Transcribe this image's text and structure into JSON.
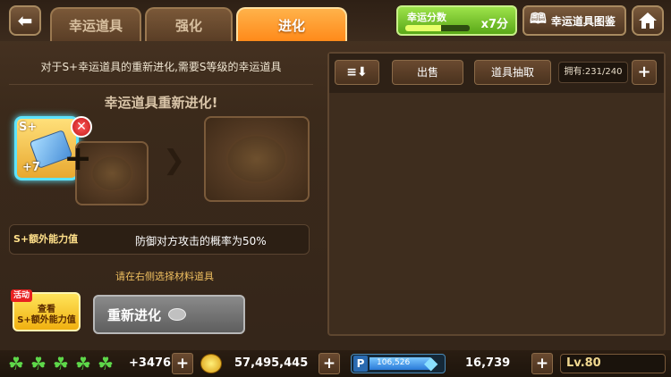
{
  "tabs": [
    {
      "label": "幸运道具"
    },
    {
      "label": "强化"
    },
    {
      "label": "进化"
    }
  ],
  "score": {
    "label": "幸运分数",
    "multiplier": "x7分",
    "fill_percent": 55
  },
  "guide_label": "幸运道具图鉴",
  "left": {
    "description": "对于S+幸运道具的重新进化,需要S等级的幸运道具",
    "title": "幸运道具重新进化!",
    "item": {
      "grade": "S+",
      "level": "+7"
    },
    "bonus_label": "S+额外能力值",
    "bonus_text": "防御对方攻击的概率为50%",
    "hint": "请在右侧选择材料道具",
    "event_tag": "活动",
    "view_label_1": "查看",
    "view_label_2": "S+额外能力值",
    "reevolve_label": "重新进化"
  },
  "right": {
    "sell_label": "出售",
    "extract_label": "道具抽取",
    "own_count": "拥有:231/240"
  },
  "bottom": {
    "clovers_extra": "+3476",
    "gold": "57,495,445",
    "p_points": "106,526",
    "p_fill_percent": 85,
    "diamonds": "16,739",
    "level": "Lv.80"
  },
  "colors": {
    "accent": "#ff8a1a",
    "score_green": "#5aa818",
    "highlight": "#5de4ff"
  },
  "icons": [
    "back-arrow-icon",
    "book-icon",
    "home-icon",
    "remove-icon",
    "plus-icon",
    "arrow-right-icon",
    "sort-icon",
    "clover-icon",
    "gold-coin-icon",
    "diamond-icon",
    "coin-icon"
  ]
}
